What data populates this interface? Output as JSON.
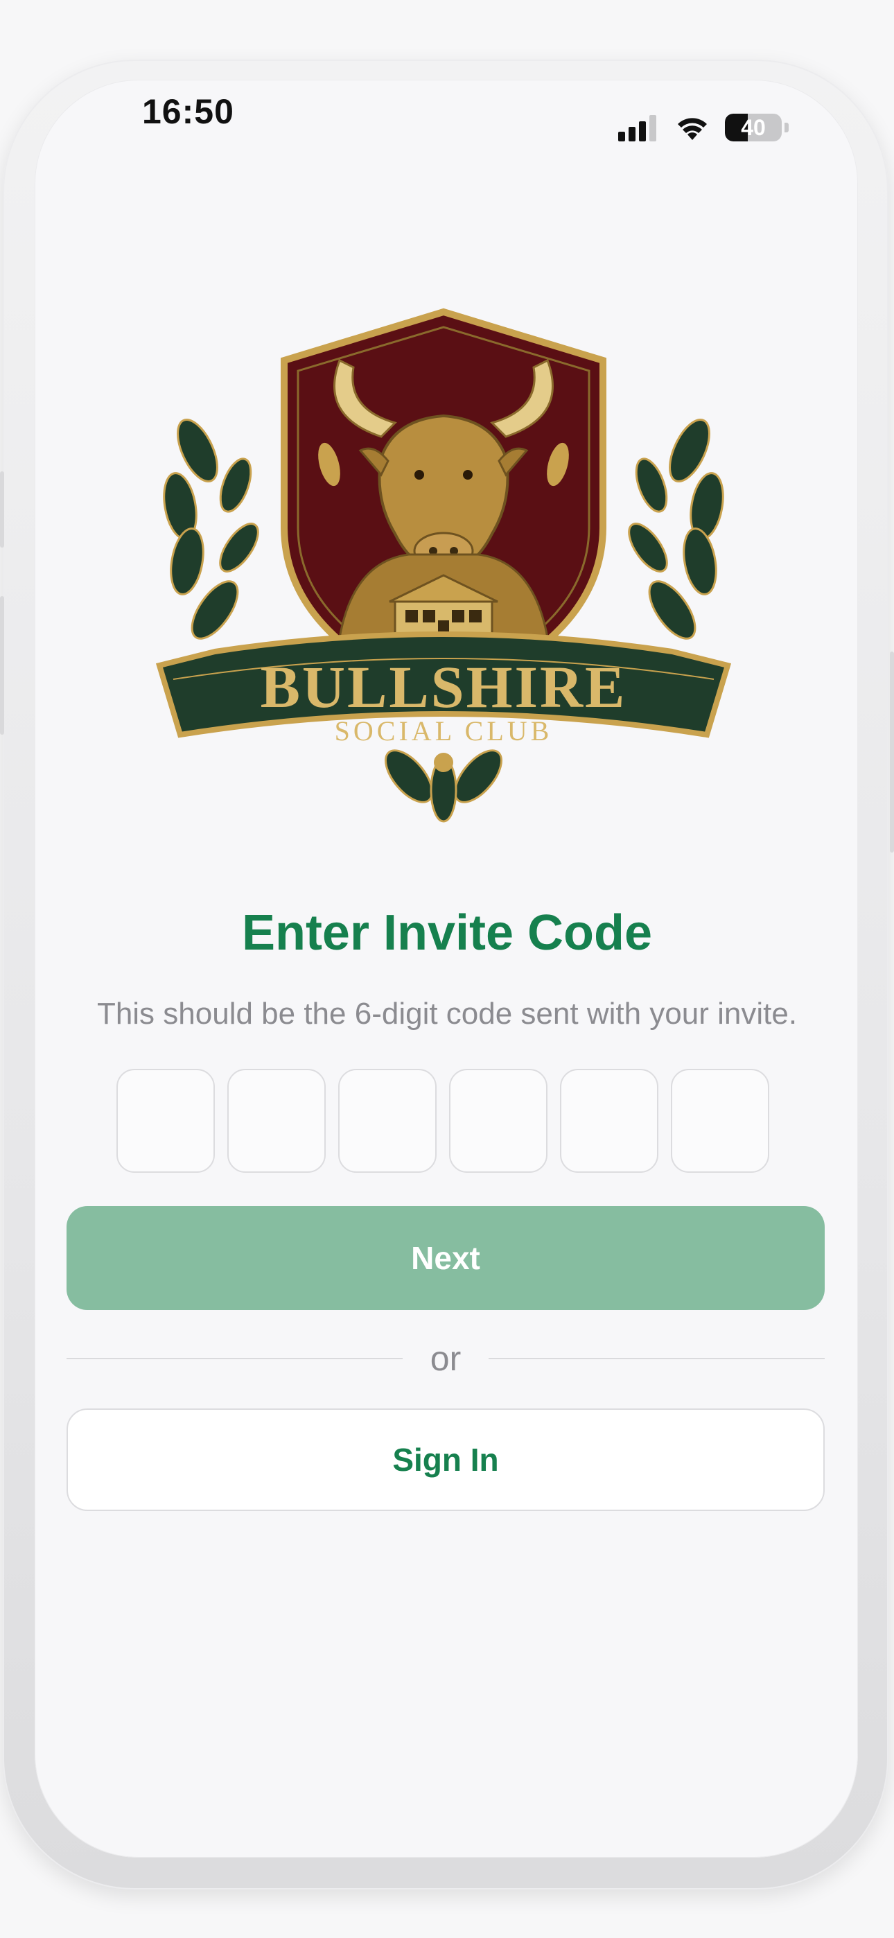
{
  "status_bar": {
    "time": "16:50",
    "battery_level": "40",
    "icons": [
      "cellular-signal-icon",
      "wifi-icon",
      "battery-icon"
    ]
  },
  "logo": {
    "name": "BULLSHIRE",
    "subtitle": "SOCIAL CLUB"
  },
  "screen": {
    "title": "Enter Invite Code",
    "instruction": "This should be the 6-digit code sent with your invite.",
    "code_digits": [
      "",
      "",
      "",
      "",
      "",
      ""
    ],
    "next_label": "Next",
    "divider_label": "or",
    "signin_label": "Sign In"
  },
  "colors": {
    "accent": "#16804e",
    "next_disabled": "#86bda0",
    "shield_red": "#5a0f14",
    "banner_green": "#1f3d2b",
    "gold": "#c9a24e"
  }
}
